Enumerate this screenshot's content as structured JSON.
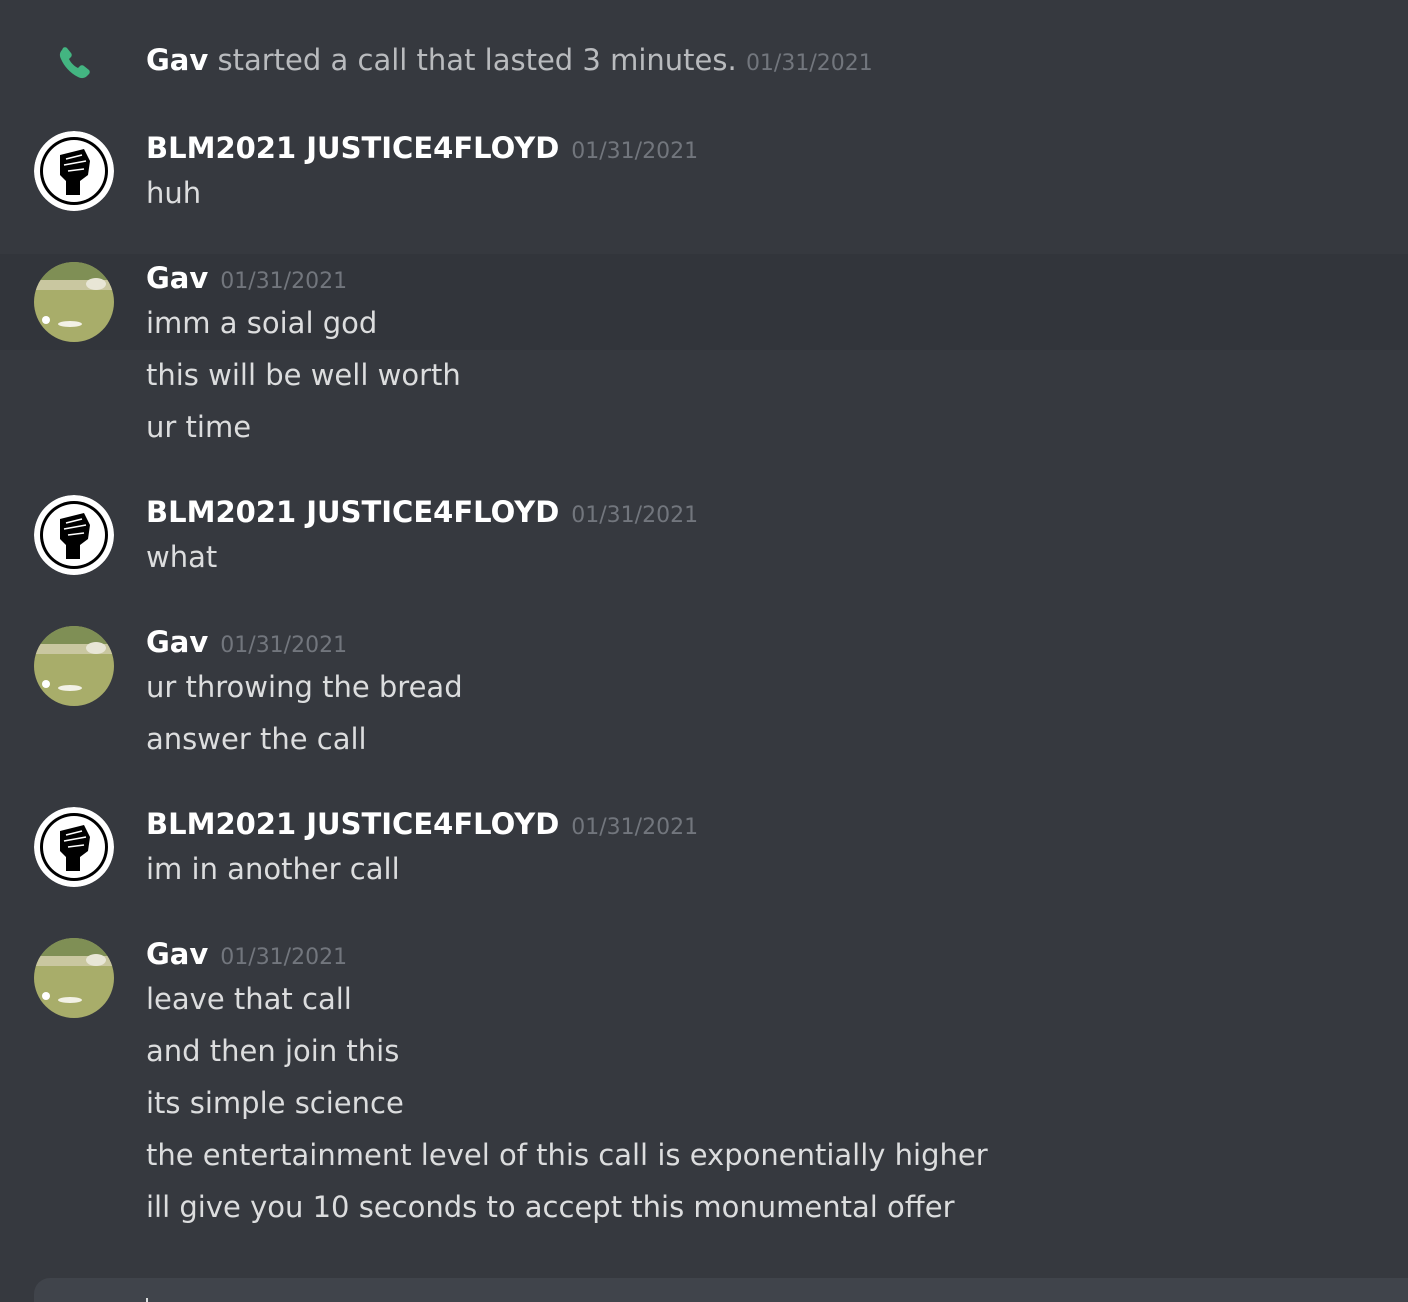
{
  "call_notice": {
    "caller": "Gav",
    "text": " started a call that lasted 3 minutes. ",
    "timestamp": "01/31/2021",
    "icon": "phone-icon",
    "icon_color": "#43b581"
  },
  "users": {
    "blm": {
      "name": "BLM2021 JUSTICE4FLOYD",
      "avatar": "raised-fist-avatar"
    },
    "gav": {
      "name": "Gav",
      "avatar": "golf-course-avatar"
    }
  },
  "messages": [
    {
      "author": "BLM2021 JUSTICE4FLOYD",
      "timestamp": "01/31/2021",
      "lines": [
        "huh"
      ]
    },
    {
      "author": "Gav",
      "timestamp": "01/31/2021",
      "lines": [
        "imm a soial god",
        "this will be well worth",
        "ur time"
      ]
    },
    {
      "author": "BLM2021 JUSTICE4FLOYD",
      "timestamp": "01/31/2021",
      "lines": [
        "what"
      ]
    },
    {
      "author": "Gav",
      "timestamp": "01/31/2021",
      "lines": [
        "ur throwing the bread",
        "answer the call"
      ]
    },
    {
      "author": "BLM2021 JUSTICE4FLOYD",
      "timestamp": "01/31/2021",
      "lines": [
        "im in another call"
      ]
    },
    {
      "author": "Gav",
      "timestamp": "01/31/2021",
      "lines": [
        "leave that call",
        "and then join this",
        "its simple science",
        "the entertainment level of this call is exponentially higher",
        "ill give you 10 seconds to accept this monumental offer"
      ]
    }
  ],
  "colors": {
    "background": "#36393f",
    "hover_background": "#32353b",
    "username": "#ffffff",
    "message_text": "#dcddde",
    "timestamp": "#72767d",
    "composer": "#40444b"
  }
}
